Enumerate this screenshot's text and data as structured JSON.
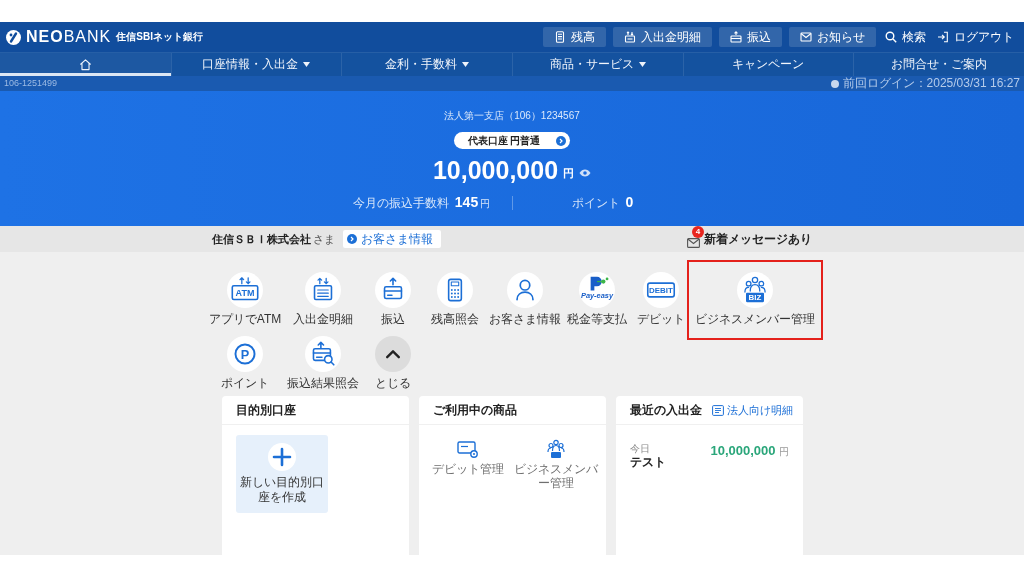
{
  "header": {
    "logo": {
      "wordmark": "**NEO**BANK",
      "bank_name": "住信SBIネット銀行"
    },
    "buttons": [
      {
        "label": "残高",
        "kind": "boxed"
      },
      {
        "label": "入出金明細",
        "kind": "boxed"
      },
      {
        "label": "振込",
        "kind": "boxed"
      },
      {
        "label": "お知らせ",
        "kind": "boxed"
      },
      {
        "label": "検索",
        "kind": "plain"
      },
      {
        "label": "ログアウト",
        "kind": "plain"
      }
    ]
  },
  "nav": {
    "tabs": [
      {
        "kind": "home",
        "selected": true
      },
      {
        "kind": "menu",
        "label": "口座情報・入出金",
        "dropdown": true,
        "selected": false
      },
      {
        "kind": "menu",
        "label": "金利・手数料",
        "dropdown": true,
        "selected": false
      },
      {
        "kind": "menu",
        "label": "商品・サービス",
        "dropdown": true,
        "selected": false
      },
      {
        "kind": "menu",
        "label": "キャンペーン",
        "dropdown": false,
        "selected": false
      },
      {
        "kind": "menu",
        "label": "お問合せ・ご案内",
        "dropdown": false,
        "selected": false
      }
    ]
  },
  "info_bar": {
    "customer_number": "106-1251499",
    "last_login": "前回ログイン：2025/03/31 16:27"
  },
  "summary": {
    "branch": "法人第一支店（106）1234567",
    "account": "代表口座 円普通",
    "balance": "10,000,000",
    "currency": "円",
    "stats": [
      {
        "label": "今月の振込手数料",
        "value": "145",
        "unit": "円"
      },
      {
        "label": "ポイント",
        "value": "0"
      }
    ]
  },
  "customer_bar": {
    "name": "住信ＳＢＩ株式会社",
    "honorific": "さま",
    "info_button": "お客さま情報",
    "messages": {
      "count": "4",
      "label": "新着メッセージあり"
    }
  },
  "shortcuts": [
    {
      "kind": "action",
      "label": "アプリでATM",
      "icon_text": "ATM",
      "highlighted": false
    },
    {
      "kind": "action",
      "label": "入出金明細",
      "highlighted": false
    },
    {
      "kind": "action",
      "label": "振込",
      "highlighted": false
    },
    {
      "kind": "action",
      "label": "残高照会",
      "highlighted": false
    },
    {
      "kind": "action",
      "label": "お客さま情報",
      "highlighted": false
    },
    {
      "kind": "action",
      "label": "税金等支払",
      "icon_text": "Pay-easy",
      "highlighted": false
    },
    {
      "kind": "action",
      "label": "デビット",
      "icon_text": "DEBIT",
      "highlighted": false
    },
    {
      "kind": "action",
      "label": "ビジネスメンバー管理",
      "icon_text": "BIZ",
      "highlighted": true
    },
    {
      "kind": "action",
      "label": "ポイント",
      "icon_text": "P",
      "highlighted": false
    },
    {
      "kind": "action",
      "label": "振込結果照会",
      "highlighted": false
    },
    {
      "kind": "collapse",
      "label": "とじる",
      "highlighted": false
    }
  ],
  "cards": [
    {
      "kind": "goal_accounts",
      "title": "目的別口座",
      "tile": "新しい目的別口座を作成"
    },
    {
      "kind": "products",
      "title": "ご利用中の商品",
      "products": [
        {
          "label": "デビット管理"
        },
        {
          "label": "ビジネスメンバー管理"
        }
      ]
    },
    {
      "kind": "transactions",
      "title": "最近の入出金",
      "link": "法人向け明細",
      "transactions": [
        {
          "date": "今日",
          "name": "テスト",
          "amount": "10,000,000",
          "unit": "円"
        }
      ]
    }
  ]
}
